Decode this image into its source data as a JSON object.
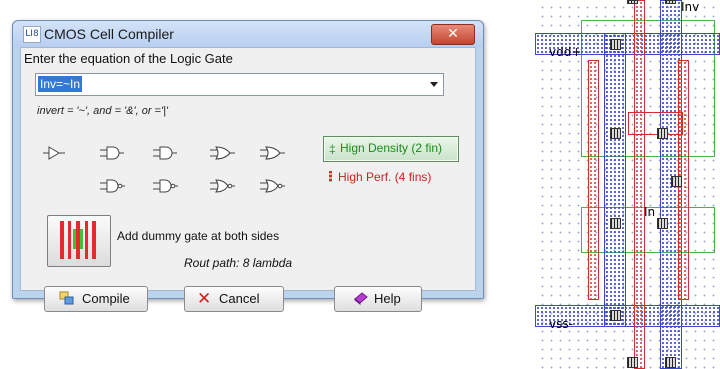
{
  "window": {
    "title": "CMOS Cell Compiler",
    "icon_text": "LI8",
    "close_glyph": "✕"
  },
  "prompt": "Enter the equation of the Logic Gate",
  "equation": {
    "value": "Inv=~In"
  },
  "hint": "invert = '~', and = '&', or ='|'",
  "gates": [
    "buffer-gate-icon",
    "and-gate-icon",
    "and-gate-icon",
    "or-gate-icon",
    "or-gate-icon",
    "nand-gate-icon",
    "nand-gate-icon",
    "nor-gate-icon",
    "nor-gate-icon"
  ],
  "options": {
    "density_label": "Hign Density (2 fin)",
    "perf_label": "High Perf. (4 fins)",
    "density_color": "#1d8a1d",
    "perf_color": "#cc2222"
  },
  "dummy_gate_label": "Add dummy gate at both sides",
  "rout_path": "Rout path: 8 lambda",
  "buttons": {
    "compile": "Compile",
    "cancel": "Cancel",
    "help": "Help"
  },
  "layout": {
    "vdd_label": "vdd+",
    "vss_label": "vss-",
    "inv_label": "Inv",
    "in_label": "In"
  }
}
